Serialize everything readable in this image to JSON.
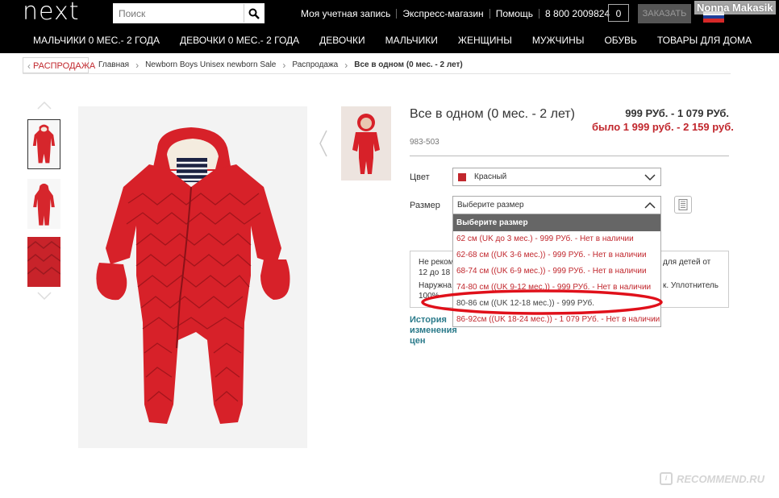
{
  "header": {
    "logo": "next",
    "search_placeholder": "Поиск",
    "links": [
      "Моя учетная запись",
      "Экспресс-магазин",
      "Помощь",
      "8 800 2009824"
    ],
    "cart_count": "0",
    "order_label": "ЗАКАЗАТЬ",
    "flag_colors": [
      "#ffffff",
      "#1f3f9a",
      "#d62828"
    ]
  },
  "nav": {
    "items": [
      "МАЛЬЧИКИ 0 МЕС.- 2 ГОДА",
      "ДЕВОЧКИ 0 МЕС.- 2 ГОДА",
      "ДЕВОЧКИ",
      "МАЛЬЧИКИ",
      "ЖЕНЩИНЫ",
      "МУЖЧИНЫ",
      "ОБУВЬ",
      "ТОВАРЫ ДЛЯ ДОМА"
    ]
  },
  "breadcrumb": {
    "back_label": "РАСПРОДАЖА",
    "items": [
      "Главная",
      "Newborn Boys Unisex newborn Sale",
      "Распродажа"
    ],
    "current": "Все в одном (0 мес. - 2 лет)"
  },
  "product": {
    "title": "Все в одном (0 мес. - 2 лет)",
    "price": "999 РУб. - 1 079 РУб.",
    "old_price": "было 1 999 руб. - 2 159 руб.",
    "code": "983-503",
    "color_label": "Цвет",
    "color_value": "Красный",
    "color_hex": "#c1272d",
    "size_label": "Размер",
    "size_placeholder": "Выберите размер",
    "history_label": "История изменения цен"
  },
  "info_box": {
    "line1_left": "Не реком",
    "line1_right": "для детей от",
    "line2_left": "12 до 18",
    "line3_left": "Наружна",
    "line3_right": "к. Уплотнитель",
    "line4_left": "100%"
  },
  "size_dropdown": {
    "header": "Выберите размер",
    "options": [
      {
        "label": "62 см (UK до 3 мес.) - 999 РУб. - Нет в наличии",
        "available": false
      },
      {
        "label": "62-68 см ((UK 3-6 мес.)) - 999 РУб. - Нет в наличии",
        "available": false
      },
      {
        "label": "68-74 см ((UK 6-9 мес.)) - 999 РУб. - Нет в наличии",
        "available": false
      },
      {
        "label": "74-80 см ((UK 9-12 мес.)) - 999 РУб. - Нет в наличии",
        "available": false
      },
      {
        "label": "80-86 см ((UK 12-18 мес.)) - 999 РУб.",
        "available": true
      },
      {
        "label": "86-92см ((UK 18-24 мес.)) - 1 079 РУб. - Нет в наличии",
        "available": false
      }
    ]
  },
  "overlay": {
    "username": "Nonna Makasik",
    "watermark": "RECOMMEND.RU",
    "highlight_color": "#e0101a"
  }
}
